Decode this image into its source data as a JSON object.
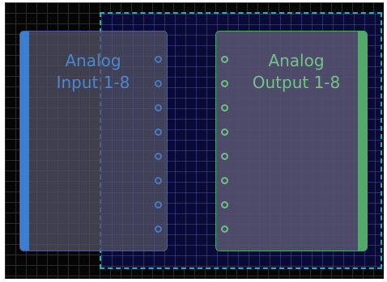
{
  "canvas": {
    "background": "#060606",
    "grid_color": "#2b2b2b"
  },
  "selection": {
    "border_color": "#2bb0b9",
    "fill_color": "#090a35"
  },
  "nodes": {
    "input": {
      "title": "Analog\nInput 1-8",
      "accent_color": "#3b7fd4",
      "port_count": 8
    },
    "output": {
      "title": "Analog\nOutput 1-8",
      "accent_color": "#52a96a",
      "port_count": 8
    }
  }
}
